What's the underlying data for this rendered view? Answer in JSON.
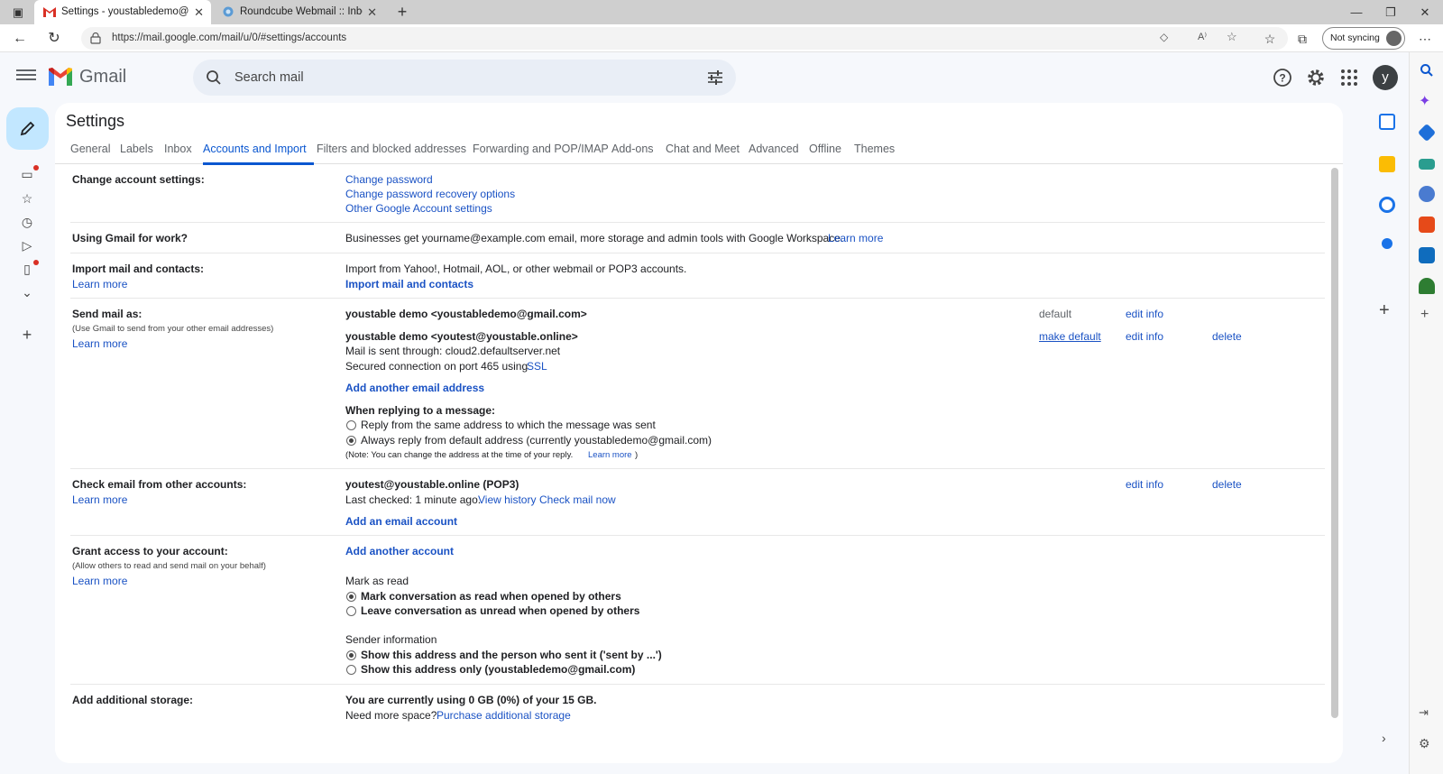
{
  "browser": {
    "tabs": [
      {
        "title": "Settings - youstabledemo@gmai"
      },
      {
        "title": "Roundcube Webmail :: Inbox"
      }
    ],
    "url": "https://mail.google.com/mail/u/0/#settings/accounts",
    "sync_label": "Not syncing"
  },
  "gmail": {
    "brand": "Gmail",
    "search_placeholder": "Search mail",
    "avatar_letter": "y"
  },
  "settings": {
    "title": "Settings",
    "tabs": [
      "General",
      "Labels",
      "Inbox",
      "Accounts and Import",
      "Filters and blocked addresses",
      "Forwarding and POP/IMAP",
      "Add-ons",
      "Chat and Meet",
      "Advanced",
      "Offline",
      "Themes"
    ],
    "change_account": {
      "label": "Change account settings:",
      "links": [
        "Change password",
        "Change password recovery options",
        "Other Google Account settings"
      ]
    },
    "work": {
      "label": "Using Gmail for work?",
      "text": "Businesses get yourname@example.com email, more storage and admin tools with Google Workspace.",
      "link": "Learn more"
    },
    "import": {
      "label": "Import mail and contacts:",
      "learn": "Learn more",
      "text": "Import from Yahoo!, Hotmail, AOL, or other webmail or POP3 accounts.",
      "action": "Import mail and contacts"
    },
    "send_as": {
      "label": "Send mail as:",
      "sub": "(Use Gmail to send from your other email addresses)",
      "learn": "Learn more",
      "addr1": "youstable demo <youstabledemo@gmail.com>",
      "addr1_status": "default",
      "addr1_edit": "edit info",
      "addr2": "youstable demo <youtest@youstable.online>",
      "addr2_make_default": "make default",
      "addr2_edit": "edit info",
      "addr2_delete": "delete",
      "sent_through": "Mail is sent through: cloud2.defaultserver.net",
      "secured": "Secured connection on port 465 using",
      "ssl": "SSL",
      "add_another": "Add another email address",
      "reply_heading": "When replying to a message:",
      "reply_opt1": "Reply from the same address to which the message was sent",
      "reply_opt2": "Always reply from default address (currently youstabledemo@gmail.com)",
      "note": "(Note: You can change the address at the time of your reply.",
      "note_learn": "Learn more",
      "note_close": ")"
    },
    "check_email": {
      "label": "Check email from other accounts:",
      "learn": "Learn more",
      "account": "youtest@youstable.online (POP3)",
      "last_checked": "Last checked: 1 minute ago.",
      "view_history": "View history",
      "check_now": "Check mail now",
      "edit": "edit info",
      "delete": "delete",
      "add": "Add an email account"
    },
    "grant": {
      "label": "Grant access to your account:",
      "sub": "(Allow others to read and send mail on your behalf)",
      "learn": "Learn more",
      "add": "Add another account",
      "mark_heading": "Mark as read",
      "mark_opt1": "Mark conversation as read when opened by others",
      "mark_opt2": "Leave conversation as unread when opened by others",
      "sender_heading": "Sender information",
      "sender_opt1": "Show this address and the person who sent it ('sent by ...')",
      "sender_opt2": "Show this address only (youstabledemo@gmail.com)"
    },
    "storage": {
      "label": "Add additional storage:",
      "using": "You are currently using 0 GB (0%) of your 15 GB.",
      "need": "Need more space?",
      "purchase": "Purchase additional storage"
    }
  },
  "colors": {
    "link": "#1a52c4",
    "active_tab": "#0b57d0",
    "compose_bg": "#c2e7ff",
    "notification_dot": "#d93025"
  }
}
